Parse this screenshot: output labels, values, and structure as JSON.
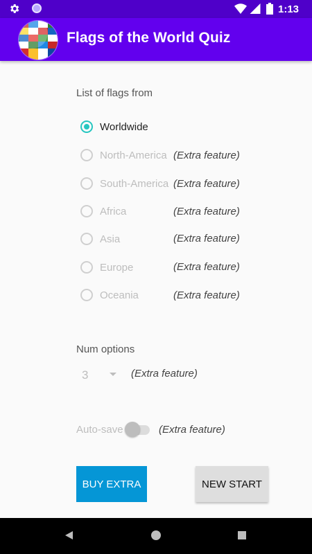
{
  "status_bar": {
    "time": "1:13"
  },
  "app": {
    "title": "Flags of the World Quiz"
  },
  "flags_section": {
    "label": "List of flags from",
    "options": [
      {
        "label": "Worldwide",
        "checked": true
      },
      {
        "label": "North-America",
        "extra": "(Extra feature)"
      },
      {
        "label": "South-America",
        "extra": "(Extra feature)"
      },
      {
        "label": "Africa",
        "extra": "(Extra feature)"
      },
      {
        "label": "Asia",
        "extra": "(Extra feature)"
      },
      {
        "label": "Europe",
        "extra": "(Extra feature)"
      },
      {
        "label": "Oceania",
        "extra": "(Extra feature)"
      }
    ]
  },
  "num_options": {
    "label": "Num options",
    "value": "3",
    "extra": "(Extra feature)"
  },
  "auto_save": {
    "label": "Auto-save",
    "extra": "(Extra feature)",
    "enabled": false
  },
  "buttons": {
    "buy_extra": "BUY EXTRA",
    "new_start": "NEW START"
  },
  "colors": {
    "status_bar": "#4f00c9",
    "app_bar": "#6200ee",
    "radio_accent": "#26c6c0",
    "buy_button": "#0596d6"
  }
}
